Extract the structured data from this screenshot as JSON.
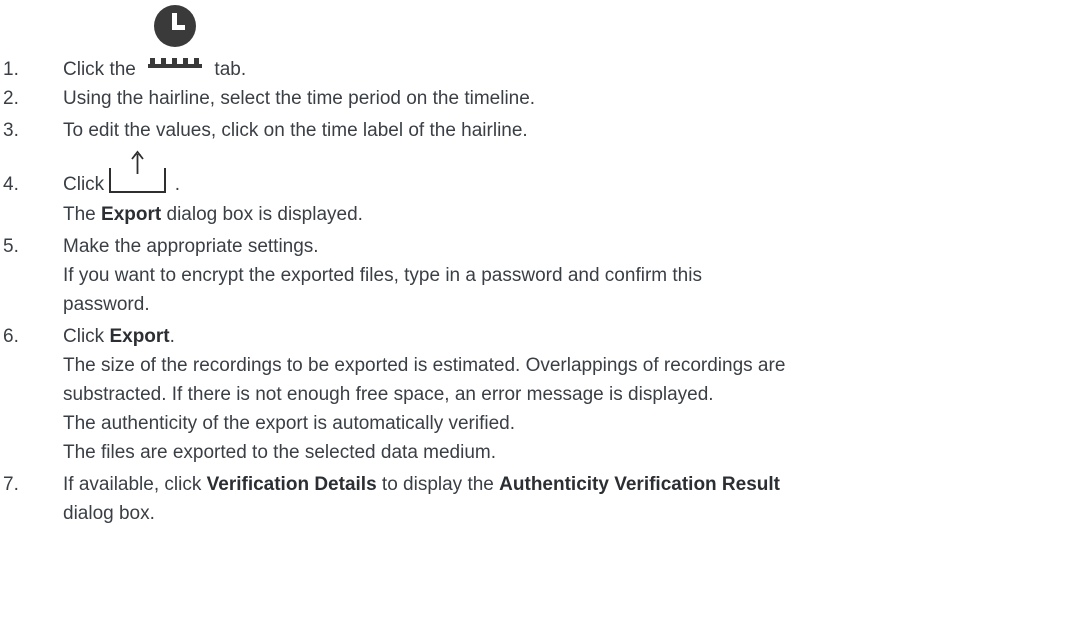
{
  "steps": [
    {
      "num": "1.",
      "pre": "Click the",
      "icon": "timeline-tab-icon",
      "post": "tab."
    },
    {
      "num": "2.",
      "text": "Using the hairline, select the time period on the timeline."
    },
    {
      "num": "3.",
      "text": "To edit the values, click on the time label of the hairline."
    },
    {
      "num": "4.",
      "pre": "Click",
      "icon": "export-icon",
      "post": ".",
      "sub": {
        "pre": "The ",
        "bold": "Export",
        "post": " dialog box is displayed."
      }
    },
    {
      "num": "5.",
      "text": "Make the appropriate settings.",
      "sub1": "If you want to encrypt the exported files, type in a password and confirm this",
      "sub2": "password."
    },
    {
      "num": "6.",
      "pre": "Click ",
      "bold": "Export",
      "post": ".",
      "sub1": "The size of the recordings to be exported is estimated. Overlappings of recordings are",
      "sub2": "substracted. If there is not enough free space, an error message is displayed.",
      "sub3": "The authenticity of the export is automatically verified.",
      "sub4": "The files are exported to the selected data medium."
    },
    {
      "num": "7.",
      "pre": "If available, click ",
      "bold1": "Verification Details",
      "mid": " to display the ",
      "bold2": "Authenticity Verification Result",
      "sub": "dialog box."
    }
  ]
}
